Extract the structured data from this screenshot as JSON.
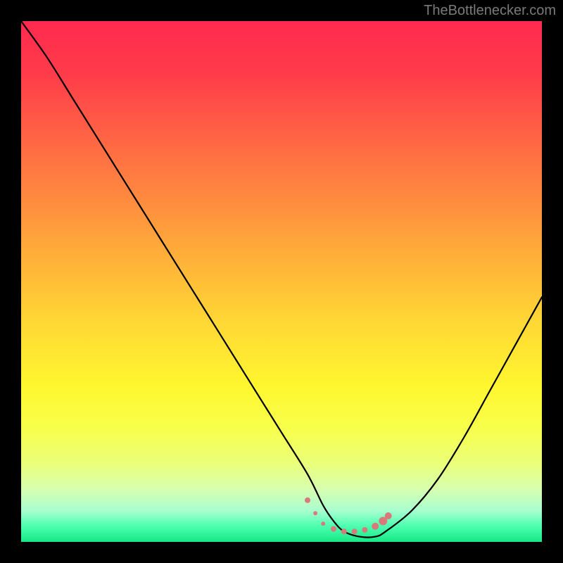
{
  "attribution": "TheBottlenecker.com",
  "chart_data": {
    "type": "line",
    "title": "",
    "xlabel": "",
    "ylabel": "",
    "xlim": [
      0,
      100
    ],
    "ylim": [
      0,
      100
    ],
    "series": [
      {
        "name": "bottleneck-curve",
        "x": [
          0,
          5,
          10,
          15,
          20,
          25,
          30,
          35,
          40,
          45,
          50,
          55,
          58,
          60,
          62,
          65,
          68,
          70,
          75,
          80,
          85,
          90,
          95,
          100
        ],
        "values": [
          100,
          93,
          85,
          77,
          69,
          61,
          53,
          45,
          37,
          29,
          21,
          13,
          7,
          4,
          2,
          1,
          1,
          2,
          6,
          12,
          20,
          29,
          38,
          47
        ]
      }
    ],
    "markers": {
      "name": "highlight-dots",
      "color": "#d87a7a",
      "points": [
        {
          "x": 55.0,
          "y": 8.0,
          "r": 4
        },
        {
          "x": 56.5,
          "y": 5.5,
          "r": 3
        },
        {
          "x": 58.0,
          "y": 3.5,
          "r": 3
        },
        {
          "x": 60.0,
          "y": 2.5,
          "r": 4
        },
        {
          "x": 62.0,
          "y": 2.0,
          "r": 4
        },
        {
          "x": 64.0,
          "y": 2.0,
          "r": 4
        },
        {
          "x": 66.0,
          "y": 2.3,
          "r": 4
        },
        {
          "x": 68.0,
          "y": 3.0,
          "r": 5
        },
        {
          "x": 69.5,
          "y": 4.0,
          "r": 6
        },
        {
          "x": 70.5,
          "y": 5.0,
          "r": 5
        }
      ]
    },
    "background_gradient": {
      "top": "#ff2a4f",
      "mid": "#ffd834",
      "bottom": "#17e884"
    }
  }
}
